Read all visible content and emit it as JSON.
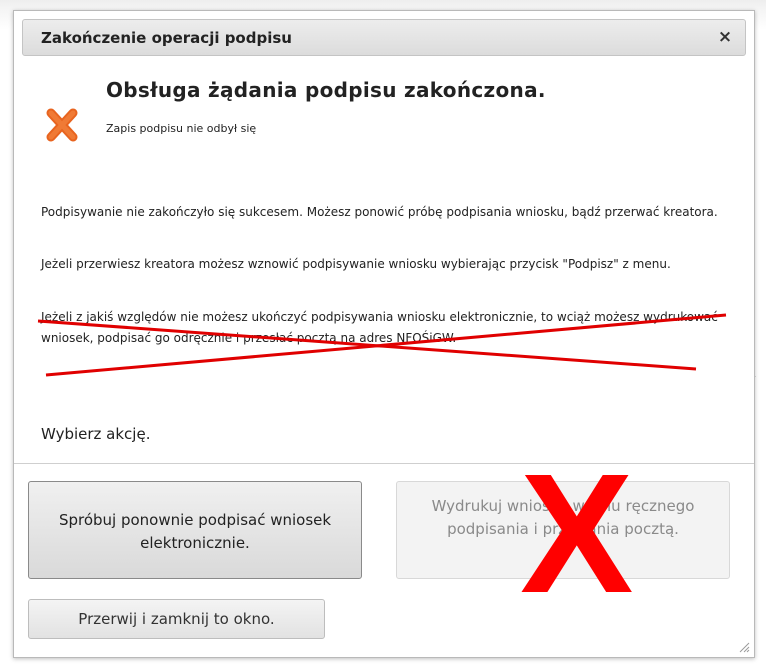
{
  "dialog": {
    "title": "Zakończenie operacji podpisu",
    "close_label": "×",
    "heading": "Obsługa żądania podpisu zakończona.",
    "subheading": "Zapis podpisu nie odbył się",
    "status_icon": "error-x-icon",
    "paragraphs": [
      "Podpisywanie nie zakończyło się sukcesem. Możesz ponowić próbę podpisania wniosku, bądź przerwać kreatora.",
      "Jeżeli przerwiesz kreatora możesz wznowić podpisywanie wniosku wybierając przycisk \"Podpisz\" z menu.",
      "Jeżeli z jakiś względów nie możesz ukończyć podpisywania wniosku elektronicznie, to wciąż możesz wydrukować wniosek, podpisać go odręcznie i przesłać pocztą na adres NFOŚiGW."
    ],
    "choose_action": "Wybierz akcję.",
    "buttons": {
      "retry": "Spróbuj ponownie podpisać wniosek elektronicznie.",
      "print": "Wydrukuj wniosek w celu ręcznego podpisania i przesłania pocztą.",
      "close": "Przerwij i zamknij to okno."
    },
    "annotation_mark": "X",
    "colors": {
      "error_icon": "#e8641f",
      "annotation": "#ff0000"
    }
  }
}
